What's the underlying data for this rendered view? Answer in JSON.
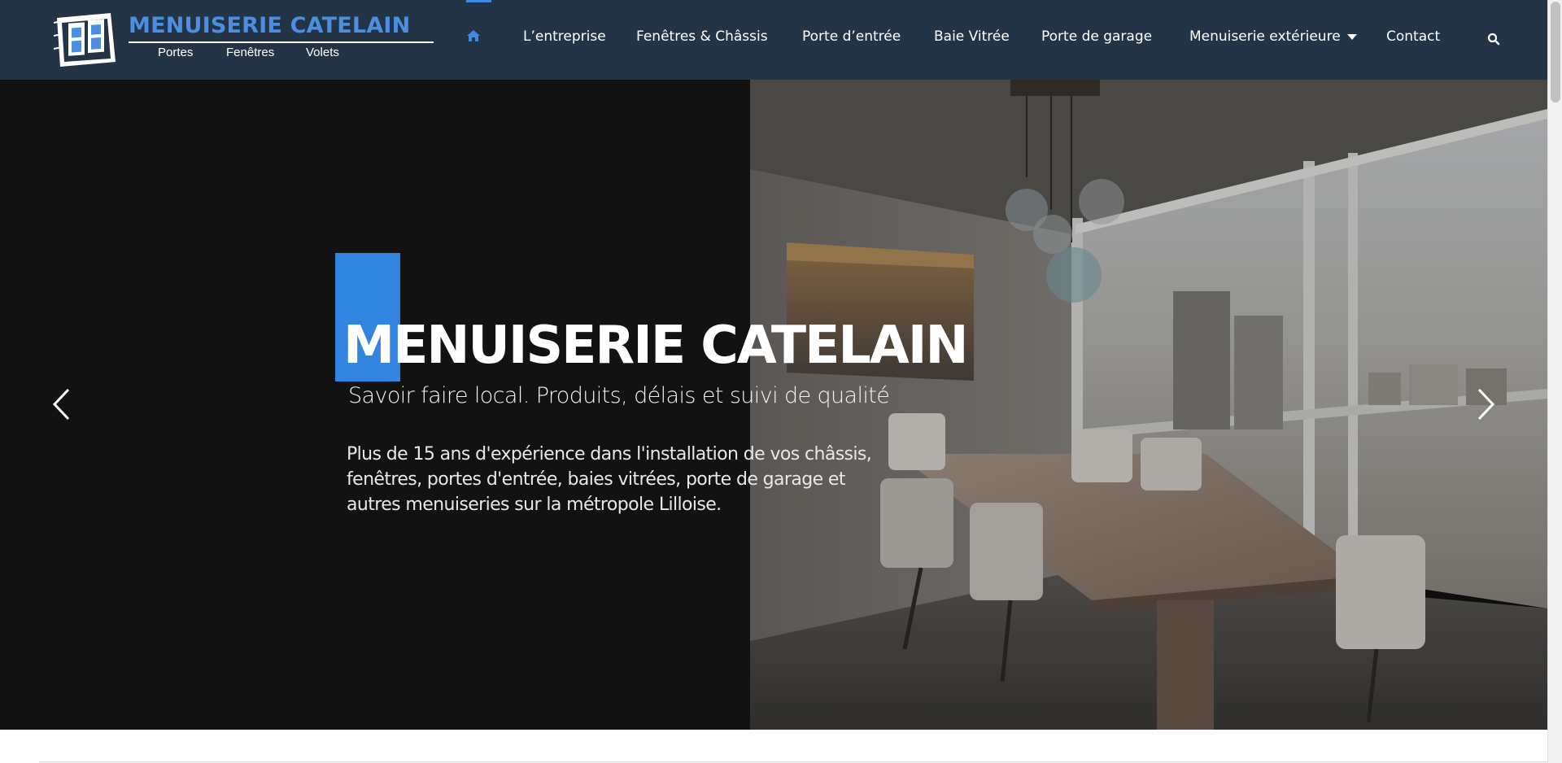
{
  "brand": {
    "name": "MENUISERIE CATELAIN",
    "tagline_items": [
      "Portes",
      "Fenêtres",
      "Volets"
    ],
    "accent_color": "#3285de",
    "header_color": "#243447"
  },
  "nav": {
    "home_icon": "home-icon",
    "items": [
      {
        "label": "L’entreprise"
      },
      {
        "label": "Fenêtres & Châssis"
      },
      {
        "label": "Porte d’entrée"
      },
      {
        "label": "Baie Vitrée"
      },
      {
        "label": "Porte de garage"
      },
      {
        "label": "Menuiserie extérieure"
      },
      {
        "label": "Contact"
      }
    ],
    "search_icon": "search-icon"
  },
  "hero": {
    "title": "MENUISERIE CATELAIN",
    "subtitle": "Savoir faire local. Produits, délais et suivi de qualité",
    "description_lines": [
      "Plus de 15 ans d'expérience dans l'installation de vos châssis,",
      "fenêtres, portes d'entrée, baies vitrées, porte de garage et",
      "autres menuiseries sur la métropole Lilloise."
    ],
    "prev_icon": "chevron-left-icon",
    "next_icon": "chevron-right-icon"
  }
}
